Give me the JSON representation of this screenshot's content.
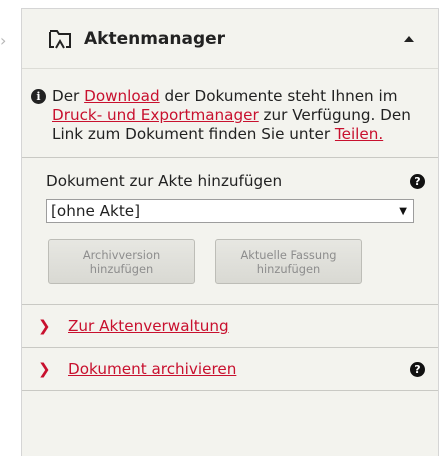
{
  "panel": {
    "title": "Aktenmanager",
    "info": {
      "part1": "Der ",
      "link1": "Download",
      "part2": " der Dokumente steht Ihnen im ",
      "link2": "Druck- und Exportmanager",
      "part3": " zur Verfügung. Den Link zum Dokument finden Sie unter ",
      "link3": "Teilen."
    },
    "add_label": "Dokument zur Akte hinzufügen",
    "select_value": "[ohne Akte]",
    "buttons": {
      "archive_line1": "Archivversion",
      "archive_line2": "hinzufügen",
      "current_line1": "Aktuelle Fassung",
      "current_line2": "hinzufügen"
    },
    "nav": [
      {
        "label": "Zur Aktenverwaltung"
      },
      {
        "label": "Dokument archivieren"
      }
    ]
  },
  "icons": {
    "folder": "folder-icon",
    "info": "info-icon",
    "help": "help-icon",
    "chevron": "chevron-right-icon",
    "collapse": "collapse-arrow-icon"
  },
  "colors": {
    "accent": "#c8102e",
    "panel_bg": "#f3f3ee"
  }
}
